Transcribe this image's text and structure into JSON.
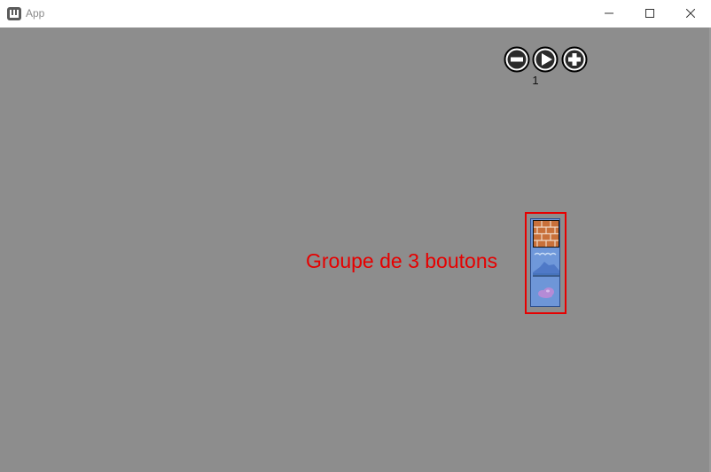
{
  "window": {
    "title": "App",
    "controls": [
      "minimize-icon",
      "maximize-icon",
      "close-icon"
    ]
  },
  "toolbar": {
    "buttons": [
      "minus-circle-icon",
      "play-circle-icon",
      "plus-circle-icon"
    ],
    "counter_value": "1"
  },
  "annotation": {
    "label": "Groupe de 3 boutons",
    "color": "#e60000"
  },
  "button_group": {
    "tiles": [
      "brick-wall-tile",
      "water-hill-tile",
      "cloud-tile"
    ]
  },
  "colors": {
    "canvas_background": "#8d8d8d",
    "titlebar_background": "#ffffff",
    "annotation_red": "#e60000"
  }
}
